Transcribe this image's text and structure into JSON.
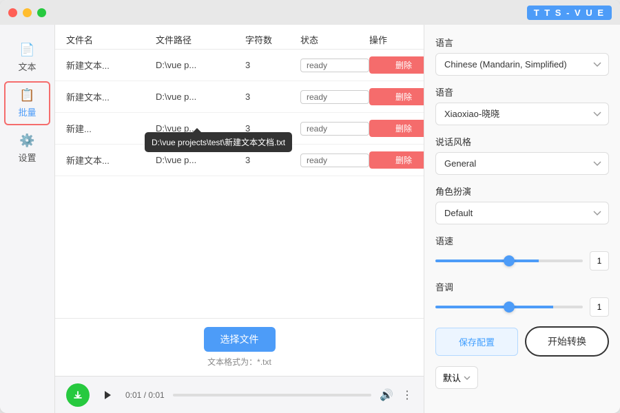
{
  "titleBar": {
    "badge": "T T S - V U E",
    "controls": [
      "close",
      "minimize",
      "maximize"
    ]
  },
  "sidebar": {
    "items": [
      {
        "id": "text",
        "label": "文本",
        "icon": "📄",
        "active": false
      },
      {
        "id": "batch",
        "label": "批量",
        "icon": "📋",
        "active": true
      },
      {
        "id": "settings",
        "label": "设置",
        "icon": "⚙️",
        "active": false
      }
    ]
  },
  "table": {
    "headers": [
      "文件名",
      "文件路径",
      "字符数",
      "状态",
      "操作"
    ],
    "rows": [
      {
        "filename": "新建文本...",
        "path": "D:\\vue p...",
        "chars": "3",
        "status": "ready"
      },
      {
        "filename": "新建文本...",
        "path": "D:\\vue p...",
        "chars": "3",
        "status": "ready"
      },
      {
        "filename": "新建...",
        "path": "D:\\vue p...",
        "chars": "3",
        "status": "ready"
      },
      {
        "filename": "新建文本...",
        "path": "D:\\vue p...",
        "chars": "3",
        "status": "ready"
      }
    ],
    "tooltip": "D:\\vue projects\\test\\新建文本文档.txt",
    "tooltipRowIndex": 2
  },
  "fileActions": {
    "selectFileLabel": "选择文件",
    "formatText": "文本格式为：*.txt"
  },
  "audioBar": {
    "time": "0:01 / 0:01",
    "progress": 0
  },
  "rightPanel": {
    "languageLabel": "语言",
    "languageValue": "Chinese (Mandarin, Simplified)",
    "voiceLabel": "语音",
    "voiceValue": "Xiaoxiao-晓晓",
    "styleLabel": "说话风格",
    "styleValue": "General",
    "roleLabel": "角色扮演",
    "roleValue": "Default",
    "speedLabel": "语速",
    "speedValue": "1",
    "pitchLabel": "音调",
    "pitchValue": "1",
    "saveConfigLabel": "保存配置",
    "startConvertLabel": "开始转换",
    "defaultLabel": "默认",
    "deleteLabel": "删除"
  }
}
